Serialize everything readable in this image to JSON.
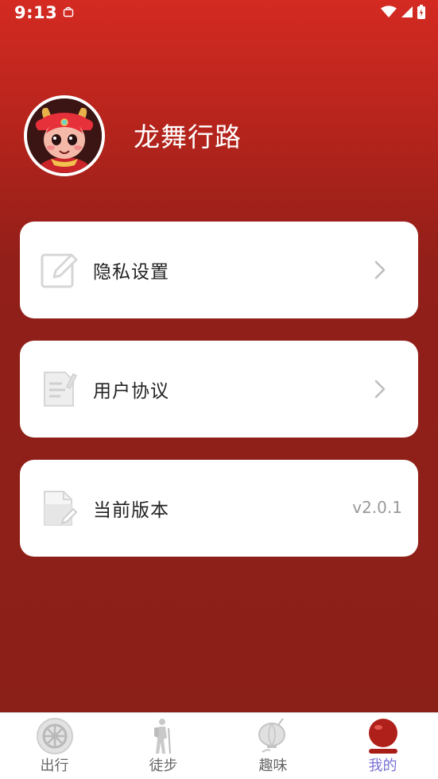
{
  "status_bar": {
    "time": "9:13"
  },
  "profile": {
    "name": "龙舞行路"
  },
  "menu": [
    {
      "label": "隐私设置",
      "icon": "edit-icon",
      "has_chevron": true
    },
    {
      "label": "用户协议",
      "icon": "document-icon",
      "has_chevron": true
    },
    {
      "label": "当前版本",
      "icon": "file-icon",
      "value": "v2.0.1"
    }
  ],
  "bottom_nav": [
    {
      "label": "出行",
      "icon": "wheel-icon",
      "active": false
    },
    {
      "label": "徒步",
      "icon": "hiker-icon",
      "active": false
    },
    {
      "label": "趣味",
      "icon": "lantern-icon",
      "active": false
    },
    {
      "label": "我的",
      "icon": "profile-ball-icon",
      "active": true
    }
  ],
  "colors": {
    "header_top": "#d42a22",
    "background": "#8b2019",
    "active_tab": "#7b72d6",
    "card": "#ffffff"
  }
}
